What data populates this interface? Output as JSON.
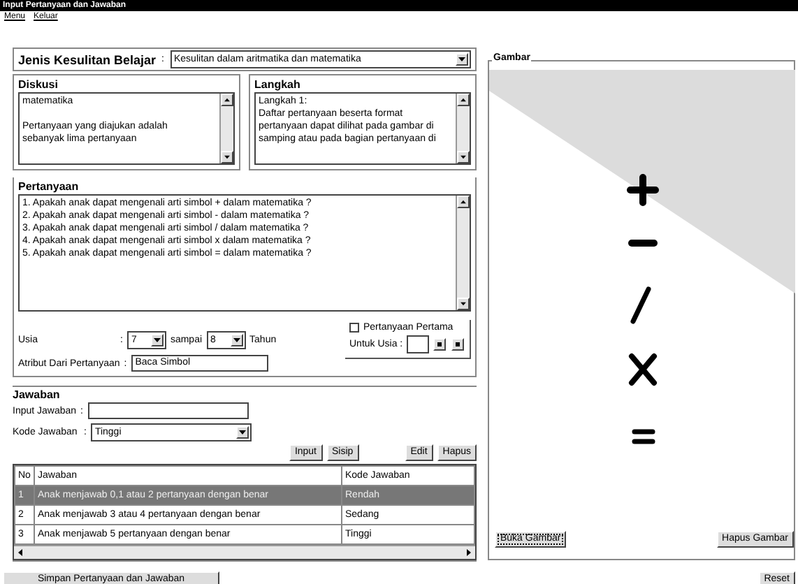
{
  "window": {
    "title": "Input Pertanyaan dan Jawaban"
  },
  "menu": [
    {
      "label": "Menu"
    },
    {
      "label": "Keluar"
    }
  ],
  "jenis": {
    "label": "Jenis Kesulitan Belajar",
    "separator": ":",
    "value": "Kesulitan dalam aritmatika dan matematika"
  },
  "diskusi": {
    "title": "Diskusi",
    "paragraphs": [
      [
        "matematika"
      ],
      [
        "Pertanyaan yang diajukan adalah",
        "sebanyak lima pertanyaan"
      ]
    ]
  },
  "langkah": {
    "title": "Langkah",
    "lines": [
      "Langkah 1:",
      "Daftar pertanyaan beserta format",
      "pertanyaan dapat dilihat pada gambar di",
      "samping atau pada bagian pertanyaan di"
    ]
  },
  "pertanyaan": {
    "title": "Pertanyaan",
    "lines": [
      "1. Apakah anak dapat mengenali arti simbol + dalam matematika ?",
      "2. Apakah anak dapat mengenali arti simbol - dalam matematika ?",
      "3. Apakah anak dapat mengenali arti simbol / dalam matematika ?",
      "4. Apakah anak dapat mengenali arti simbol x dalam matematika ?",
      "5. Apakah anak dapat mengenali arti simbol = dalam matematika ?"
    ]
  },
  "usia": {
    "label": "Usia",
    "separator": ":",
    "from": "7",
    "to_label": "sampai",
    "to": "8",
    "unit": "Tahun"
  },
  "atribut": {
    "label": "Atribut Dari Pertanyaan",
    "separator": ":",
    "value": "Baca Simbol"
  },
  "pertama": {
    "label": "Pertanyaan Pertama",
    "checked": false,
    "usia_label": "Untuk Usia :"
  },
  "jawaban": {
    "title": "Jawaban",
    "input_label": "Input Jawaban",
    "input_sep": ":",
    "kode_label": "Kode Jawaban",
    "kode_sep": ":",
    "kode_value": "Tinggi",
    "buttons": [
      "Input",
      "Sisip",
      "Edit",
      "Hapus"
    ],
    "table": {
      "columns": [
        "No",
        "Jawaban",
        "Kode Jawaban"
      ],
      "rows": [
        {
          "cells": [
            "1",
            "Anak menjawab 0,1 atau 2 pertanyaan dengan benar",
            "Rendah"
          ],
          "selected": true
        },
        {
          "cells": [
            "2",
            "Anak menjawab 3 atau 4 pertanyaan dengan benar",
            "Sedang"
          ],
          "selected": false
        },
        {
          "cells": [
            "3",
            "Anak menjawab 5 pertanyaan dengan benar",
            "Tinggi"
          ],
          "selected": false
        }
      ]
    }
  },
  "save_button": "Simpan Pertanyaan dan Jawaban",
  "gambar": {
    "title": "Gambar",
    "open_button": "Buka Gambar",
    "delete_button": "Hapus Gambar"
  },
  "reset_button": "Reset"
}
